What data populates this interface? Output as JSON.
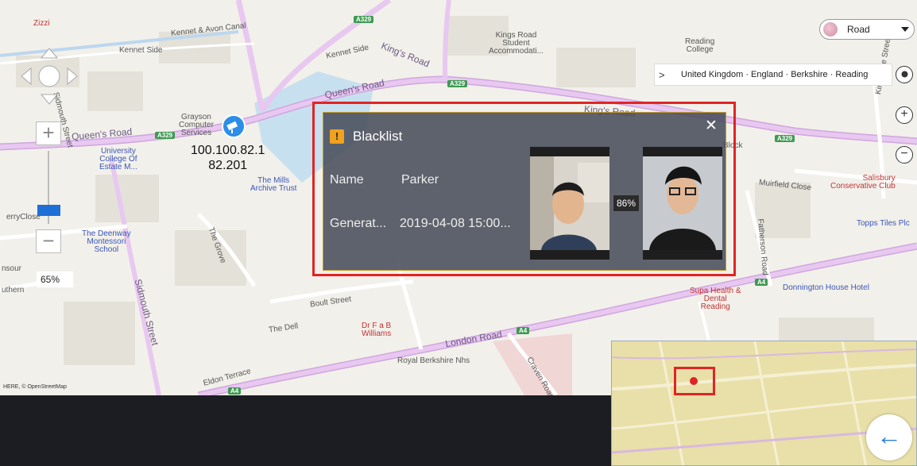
{
  "map": {
    "attribution": "HERE, © OpenStreetMap",
    "labels": {
      "zizzi": "Zizzi",
      "kennet_avon": "Kennet & Avon Canal",
      "kennet_side": "Kennet Side",
      "kennet_side2": "Kennet Side",
      "kings_road": "King's Road",
      "kings_road2": "King's Road",
      "kings_road_accom": "Kings Road\nStudent\nAccommodati...",
      "reading_college": "Reading\nCollege",
      "queens_road": "Queen's Road",
      "queens_road2": "Queen's Road",
      "grayson": "Grayson\nComputer\nServices",
      "university_college": "University\nCollege Of\nEstate M...",
      "the_mills": "The Mills\nArchive Trust",
      "sidmouth_street": "Sidmouth Street",
      "sidmouth_street2": "Sidmouth Street",
      "the_deenway": "The Deenway\nMontessori\nSchool",
      "the_grove": "The Grove",
      "boults_street": "Boult Street",
      "the_dell": "The Dell",
      "dr_fab": "Dr F a B\nWilliams",
      "london_road": "London Road",
      "royal_berkshire": "Royal Berkshire Nhs",
      "eldon_terrace": "Eldon Terrace",
      "craven_road": "Craven Road",
      "supa_health": "Supa Health &\nDental\nReading",
      "donnington": "Donnington House Hotel",
      "muirfield": "Muirfield Close",
      "salisbury": "Salisbury\nConservative Club",
      "topps": "Topps Tiles Plc",
      "kingsgate": "Kingsgate Street",
      "fatherson": "Fatherson Road",
      "road_block": "Block",
      "a329_1": "A329",
      "a329_2": "A329",
      "a329_3": "A329",
      "a329_4": "A329",
      "a4_1": "A4",
      "a4_2": "A4",
      "a4_3": "A4",
      "ferry": "erryClose",
      "source": "nsour",
      "athern": "uthern"
    }
  },
  "layer_select": {
    "value": "Road"
  },
  "breadcrumb": {
    "path": "United Kingdom · England · Berkshire · Reading"
  },
  "controls": {
    "zoom_level": "65%"
  },
  "camera": {
    "ip": "100.100.82.1\n82.201"
  },
  "popup": {
    "title": "Blacklist",
    "name_label": "Name",
    "name_value": "Parker",
    "generated_label": "Generat...",
    "generated_value": "2019-04-08 15:00...",
    "similarity": "86%"
  }
}
